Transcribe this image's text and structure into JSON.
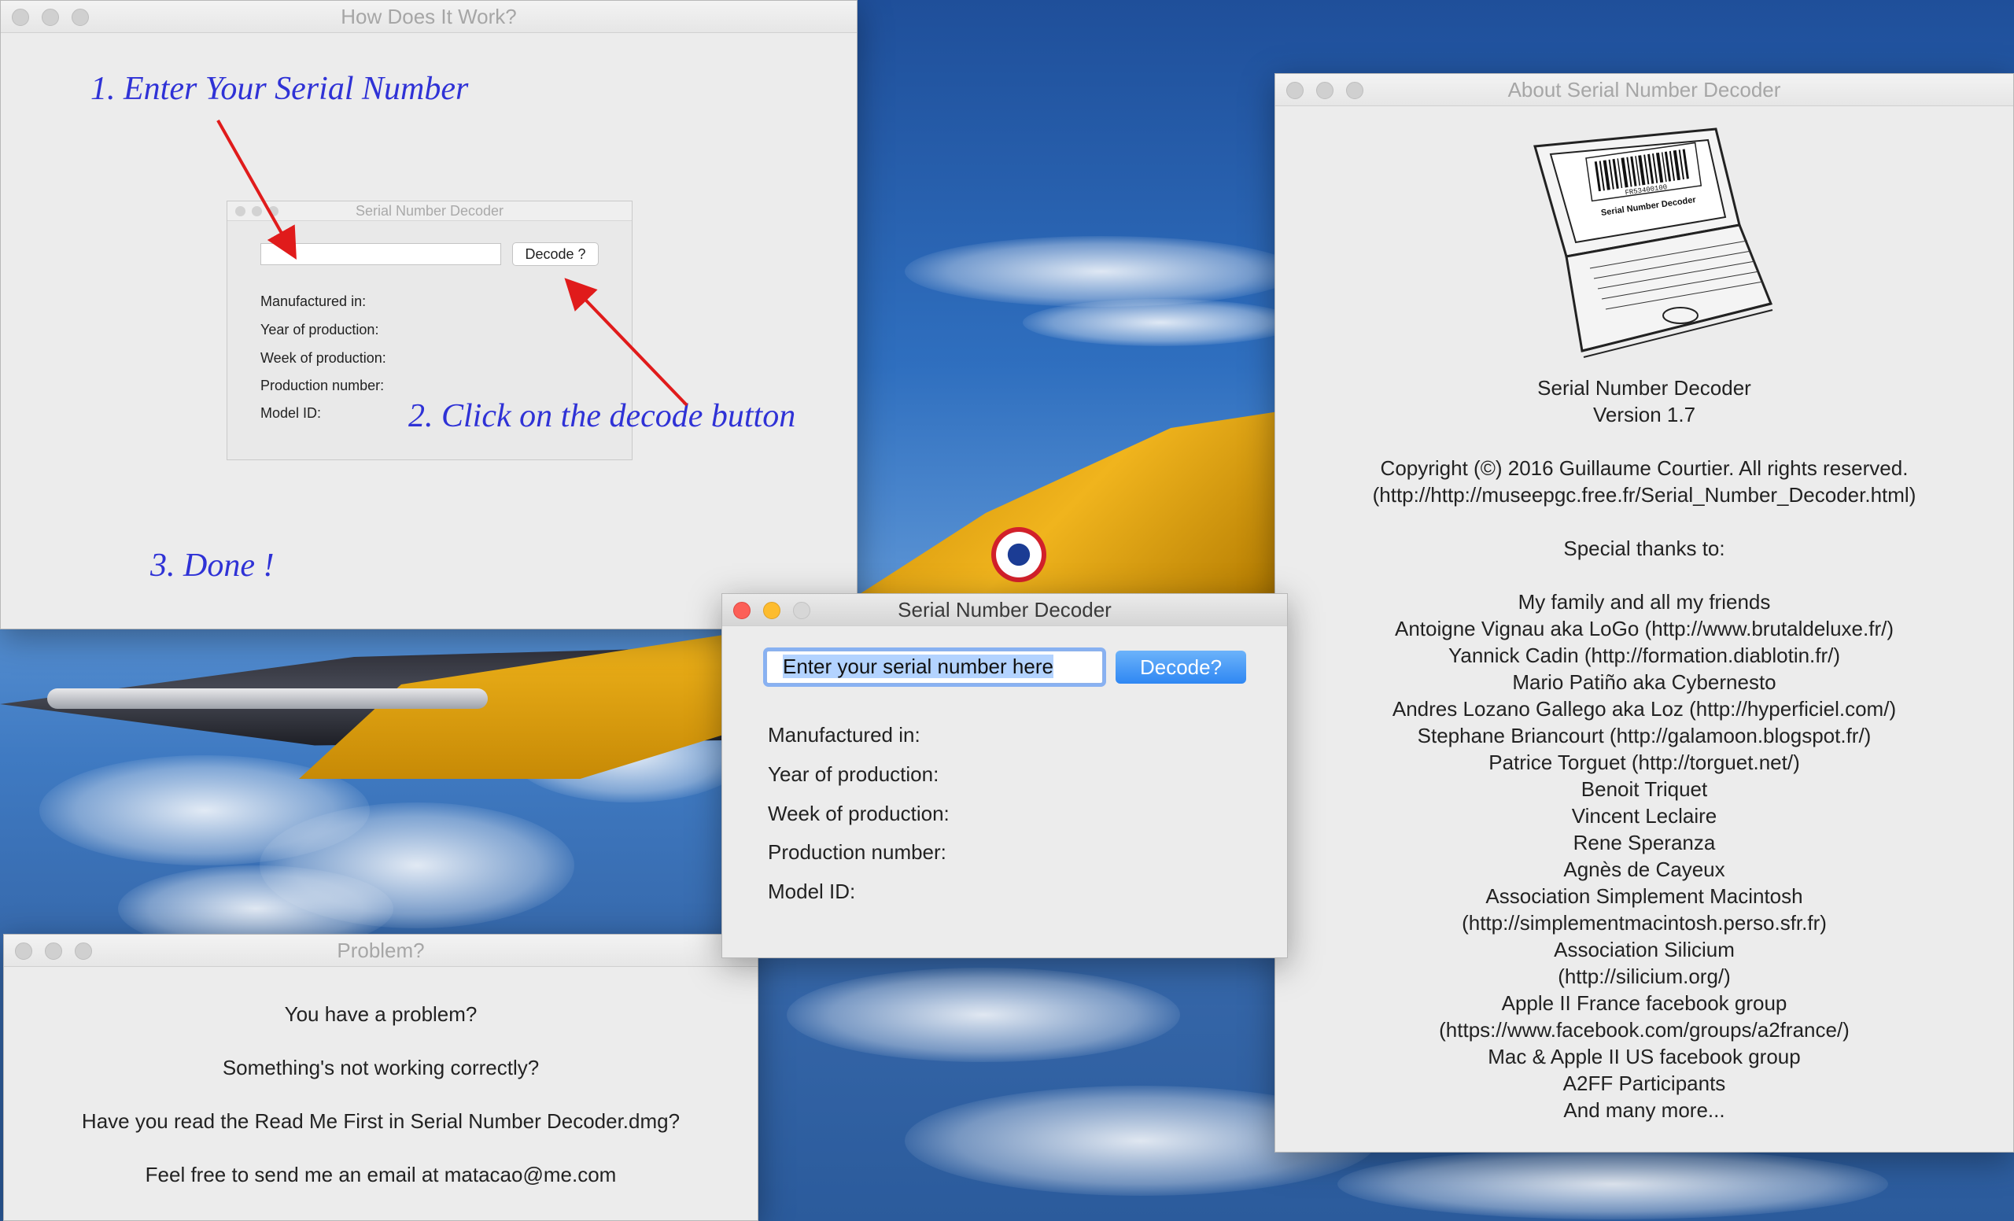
{
  "how_window": {
    "title": "How Does It Work?",
    "step1": "1. Enter Your Serial Number",
    "step2": "2. Click on the decode button",
    "step3": "3. Done !",
    "mini_title": "Serial Number Decoder",
    "mini_button": "Decode ?",
    "mini_labels": [
      "Manufactured in:",
      "Year of production:",
      "Week of production:",
      "Production number:",
      "Model ID:"
    ]
  },
  "problem_window": {
    "title": "Problem?",
    "lines": [
      "You have a problem?",
      "Something's not working correctly?",
      "Have you read the Read Me First in Serial Number Decoder.dmg?",
      "Feel free to send me an email at matacao@me.com"
    ]
  },
  "decoder_window": {
    "title": "Serial Number Decoder",
    "input_value": "Enter your serial number here",
    "button": "Decode?",
    "labels": [
      "Manufactured in:",
      "Year of production:",
      "Week of production:",
      "Production number:",
      "Model ID:"
    ]
  },
  "about_window": {
    "title": "About Serial Number Decoder",
    "app_name": "Serial Number Decoder",
    "version": "Version 1.7",
    "copyright": "Copyright (©) 2016 Guillaume Courtier. All rights reserved.",
    "url": "(http://http://museepgc.free.fr/Serial_Number_Decoder.html)",
    "thanks_heading": "Special thanks to:",
    "thanks": [
      "My family and all my friends",
      "Antoigne Vignau aka LoGo (http://www.brutaldeluxe.fr/)",
      "Yannick Cadin (http://formation.diablotin.fr/)",
      "Mario Patiño aka Cybernesto",
      "Andres Lozano Gallego aka Loz (http://hyperficiel.com/)",
      "Stephane Briancourt (http://galamoon.blogspot.fr/)",
      "Patrice Torguet (http://torguet.net/)",
      "Benoit Triquet",
      "Vincent Leclaire",
      "Rene Speranza",
      "Agnès de Cayeux",
      "Association Simplement Macintosh",
      "(http://simplementmacintosh.perso.sfr.fr)",
      "Association Silicium",
      "(http://silicium.org/)",
      "Apple II France facebook group",
      "(https://www.facebook.com/groups/a2france/)",
      "Mac & Apple II US facebook group",
      "A2FF Participants",
      "And many more..."
    ],
    "laptop_screen_text": "Serial Number Decoder",
    "barcode_text": "FR53400100"
  }
}
